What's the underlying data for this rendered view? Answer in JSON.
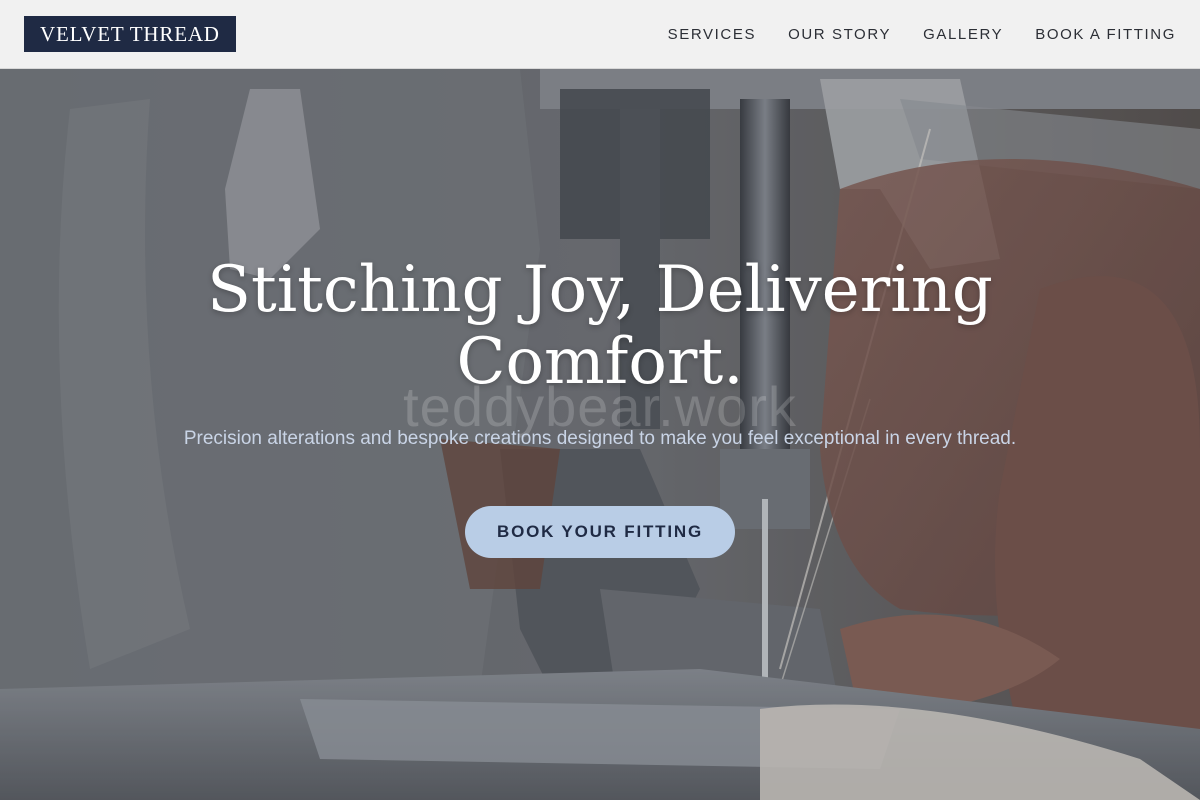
{
  "brand": {
    "logo_text": "VELVET THREAD"
  },
  "nav": {
    "items": [
      {
        "label": "SERVICES"
      },
      {
        "label": "OUR STORY"
      },
      {
        "label": "GALLERY"
      },
      {
        "label": "BOOK A FITTING"
      }
    ]
  },
  "hero": {
    "title_line1": "Stitching Joy, Delivering",
    "title_line2": "Comfort.",
    "watermark": "teddybear.work",
    "subtitle": "Precision alterations and bespoke creations designed to make you feel exceptional in every thread.",
    "cta_label": "BOOK YOUR FITTING",
    "background_image": "sewing-machine-photo"
  },
  "colors": {
    "header_bg": "#f1f1f1",
    "logo_bg": "#1f2a44",
    "cta_bg": "#b9cde6",
    "cta_text": "#1f2a44"
  }
}
